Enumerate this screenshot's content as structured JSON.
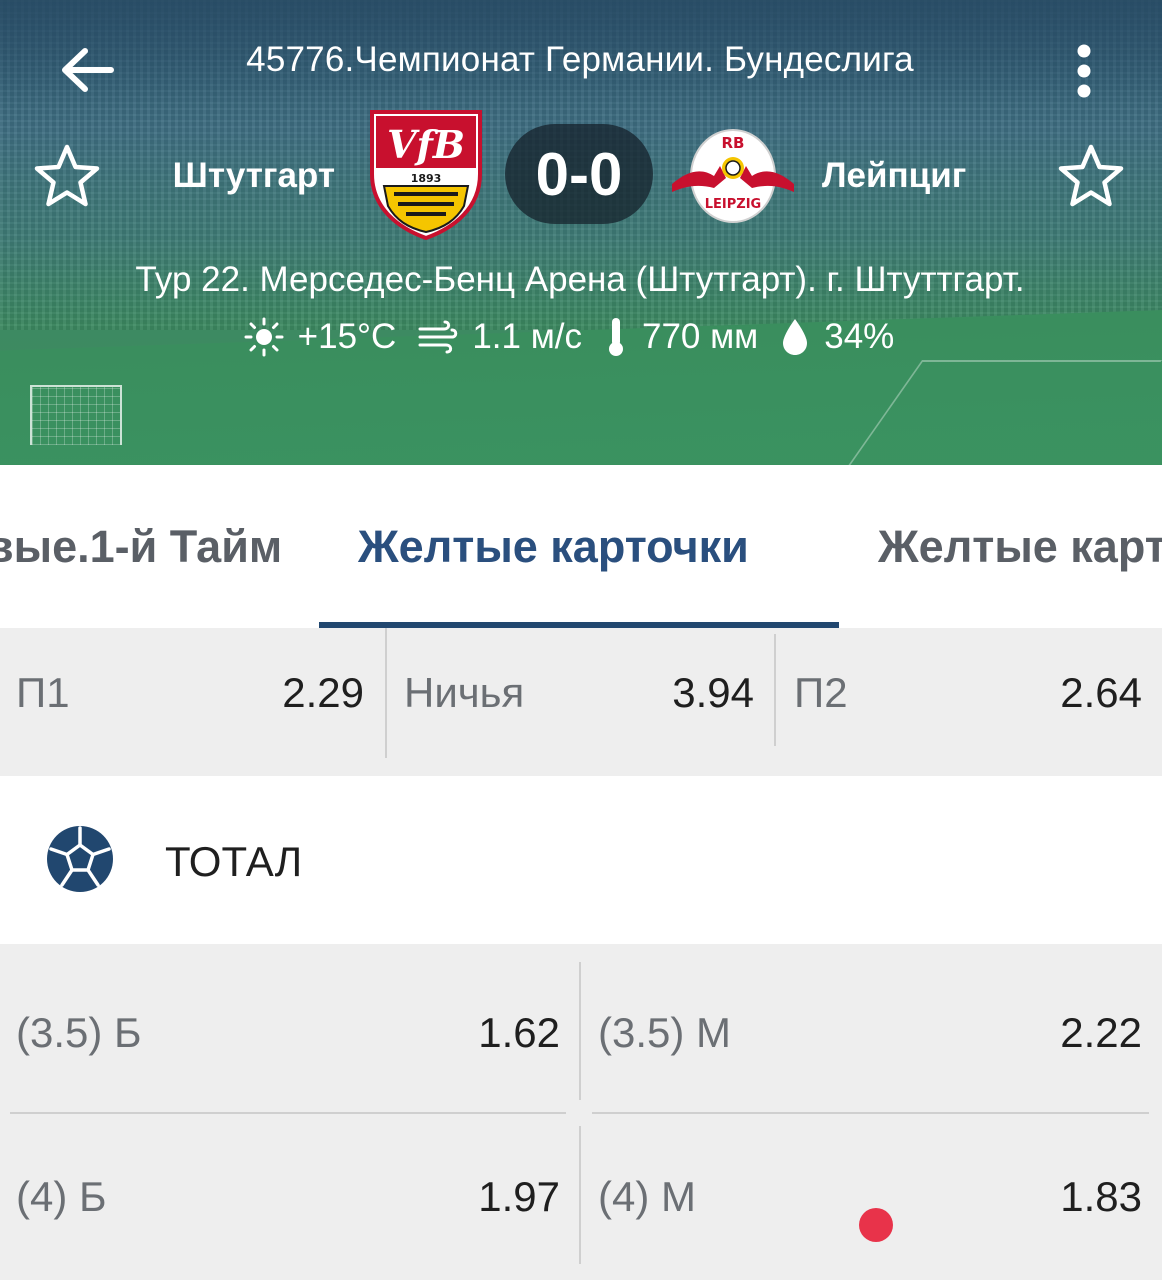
{
  "header": {
    "league_title": "45776.Чемпионат Германии. Бундеслига",
    "team1": "Штутгарт",
    "team2": "Лейпциг",
    "score": "0-0",
    "venue": "Тур 22. Мерседес-Бенц Арена (Штутгарт). г. Штуттгарт.",
    "weather": {
      "temperature": "+15°C",
      "wind": "1.1 м/с",
      "pressure": "770 мм",
      "humidity": "34%"
    }
  },
  "logos": {
    "team1_text": "1893",
    "team2_text": "LEIPZIG",
    "team2_top": "RB"
  },
  "tabs": [
    {
      "label": "вые.1-й  Тайм"
    },
    {
      "label": "Желтые карточки"
    },
    {
      "label": "Желтые карт"
    }
  ],
  "main_odds": [
    {
      "label": "П1",
      "value": "2.29"
    },
    {
      "label": "Ничья",
      "value": "3.94"
    },
    {
      "label": "П2",
      "value": "2.64"
    }
  ],
  "total_section": {
    "title": "ТОТАЛ",
    "rows": [
      [
        {
          "label": "(3.5) Б",
          "value": "1.62"
        },
        {
          "label": "(3.5) М",
          "value": "2.22"
        }
      ],
      [
        {
          "label": "(4) Б",
          "value": "1.97"
        },
        {
          "label": "(4) М",
          "value": "1.83"
        }
      ]
    ]
  },
  "colors": {
    "accent": "#2a4f7e",
    "indicator": "#21476f",
    "row_bg": "#eeeeee",
    "dot": "#e8334a"
  }
}
